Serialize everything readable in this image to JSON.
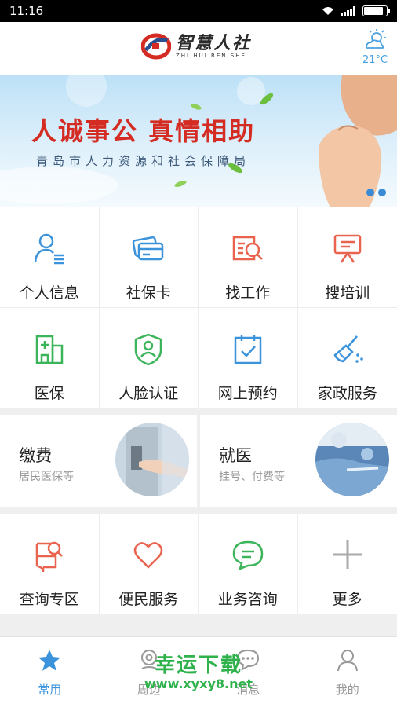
{
  "status_bar": {
    "time": "11:16",
    "battery_level": 0.9
  },
  "header": {
    "logo_cn": "智慧人社",
    "logo_en": "ZHI HUI REN SHE",
    "logo_icon": "logo-mark",
    "weather": {
      "icon": "sun-cloud-icon",
      "temp": "21°C"
    }
  },
  "banner": {
    "title": "人诚事公 真情相助",
    "subtitle": "青岛市人力资源和社会保障局",
    "dots_count": 2
  },
  "grid_top": [
    {
      "label": "个人信息",
      "icon": "person-info-icon",
      "color": "#3b93dc"
    },
    {
      "label": "社保卡",
      "icon": "card-icon",
      "color": "#3b93dc"
    },
    {
      "label": "找工作",
      "icon": "job-search-icon",
      "color": "#e9634f"
    },
    {
      "label": "搜培训",
      "icon": "training-icon",
      "color": "#e9634f"
    },
    {
      "label": "医保",
      "icon": "medical-insurance-icon",
      "color": "#3cb45a"
    },
    {
      "label": "人脸认证",
      "icon": "face-auth-icon",
      "color": "#3cb45a"
    },
    {
      "label": "网上预约",
      "icon": "calendar-check-icon",
      "color": "#3b93dc"
    },
    {
      "label": "家政服务",
      "icon": "broom-icon",
      "color": "#3b93dc"
    }
  ],
  "cards": [
    {
      "title": "缴费",
      "subtitle": "居民医保等"
    },
    {
      "title": "就医",
      "subtitle": "挂号、付费等"
    }
  ],
  "grid_bottom": [
    {
      "label": "查询专区",
      "icon": "query-icon",
      "color": "#e9634f"
    },
    {
      "label": "便民服务",
      "icon": "heart-icon",
      "color": "#e9634f"
    },
    {
      "label": "业务咨询",
      "icon": "chat-icon",
      "color": "#3cb45a"
    },
    {
      "label": "更多",
      "icon": "plus-icon",
      "color": "#aaaaaa"
    }
  ],
  "tabbar": [
    {
      "label": "常用",
      "icon": "star-icon",
      "active": true
    },
    {
      "label": "周边",
      "icon": "location-icon",
      "active": false
    },
    {
      "label": "消息",
      "icon": "message-icon",
      "active": false
    },
    {
      "label": "我的",
      "icon": "user-icon",
      "active": false
    }
  ],
  "watermark": {
    "text": "幸运下载",
    "url": "www.xyxy8.net"
  },
  "colors": {
    "accent": "#3b93dc",
    "red": "#e9634f",
    "green": "#3cb45a",
    "banner_red": "#d42b22"
  }
}
